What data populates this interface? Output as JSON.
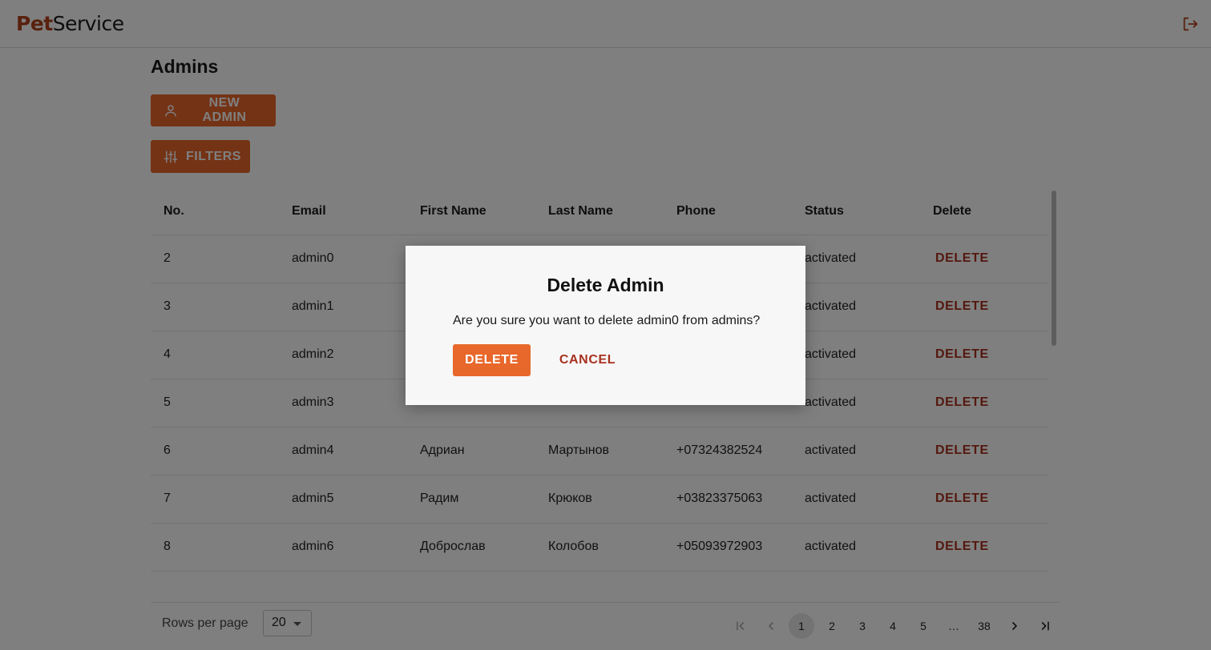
{
  "header": {
    "logo_part1": "Pet",
    "logo_part2": "Service",
    "logout_icon": "logout-icon"
  },
  "page": {
    "title": "Admins",
    "new_admin_label": "NEW ADMIN",
    "filters_label": "FILTERS"
  },
  "table": {
    "columns": [
      "No.",
      "Email",
      "First Name",
      "Last Name",
      "Phone",
      "Status",
      "Delete"
    ],
    "delete_label": "DELETE",
    "rows": [
      {
        "no": "2",
        "email": "admin0",
        "first": "",
        "last": "",
        "phone": "",
        "status": "activated"
      },
      {
        "no": "3",
        "email": "admin1",
        "first": "",
        "last": "",
        "phone": "",
        "status": "activated"
      },
      {
        "no": "4",
        "email": "admin2",
        "first": "",
        "last": "",
        "phone": "",
        "status": "activated"
      },
      {
        "no": "5",
        "email": "admin3",
        "first": "",
        "last": "",
        "phone": "",
        "status": "activated"
      },
      {
        "no": "6",
        "email": "admin4",
        "first": "Адриан",
        "last": "Мартынов",
        "phone": "+07324382524",
        "status": "activated"
      },
      {
        "no": "7",
        "email": "admin5",
        "first": "Радим",
        "last": "Крюков",
        "phone": "+03823375063",
        "status": "activated"
      },
      {
        "no": "8",
        "email": "admin6",
        "first": "Доброслав",
        "last": "Колобов",
        "phone": "+05093972903",
        "status": "activated"
      },
      {
        "no": "",
        "email": "",
        "first": "",
        "last": "",
        "phone": "",
        "status": ""
      }
    ]
  },
  "footer": {
    "rows_per_page_label": "Rows per page",
    "rows_per_page_value": "20",
    "pages": [
      "1",
      "2",
      "3",
      "4",
      "5",
      "…",
      "38"
    ],
    "current_page": "1"
  },
  "dialog": {
    "title": "Delete Admin",
    "message": "Are you sure you want to delete admin0 from admins?",
    "confirm_label": "DELETE",
    "cancel_label": "CANCEL"
  },
  "colors": {
    "accent": "#e8672a",
    "danger_text": "#a8311f",
    "logo_accent": "#b0431d",
    "overlay": "rgba(0,0,0,0.5)"
  }
}
